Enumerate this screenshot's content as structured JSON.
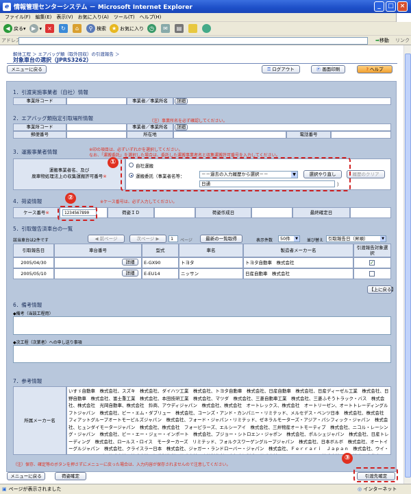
{
  "window": {
    "title": "情報管理センターシステム － Microsoft Internet Explorer",
    "min": "_",
    "max": "□",
    "close": "×"
  },
  "menu": [
    "ファイル(F)",
    "編集(E)",
    "表示(V)",
    "お気に入り(A)",
    "ツール(T)",
    "ヘルプ(H)"
  ],
  "toolbar": {
    "back": "戻る",
    "search": "検索",
    "favorites": "お気に入り"
  },
  "address": {
    "label": "アドレス(D)",
    "go": "移動",
    "links": "リンク"
  },
  "page": {
    "breadcrumb": "解体工程 ＞ エアバッグ類（取外回収）の引渡報告 ＞",
    "title": "対象車台の選択（JPRS3262）",
    "menu_back": "メニューに戻る",
    "logout": "ログアウト",
    "print": "画面印刷",
    "help": "ヘルプ"
  },
  "s1": {
    "heading": "1．引渡実施事業者（自社）情報",
    "code_label": "事業所コード",
    "name_label": "事業者／事業所名",
    "detail": "詳細"
  },
  "s2": {
    "heading": "2．エアバッグ類指定引取場所情報",
    "note": "（注）事業所名を必ず確認してください。",
    "code_label": "事業所コード",
    "name_label": "事業者／事業所名",
    "detail": "詳細",
    "zip_label": "郵便番号",
    "addr_label": "所在地",
    "tel_label": "電話番号"
  },
  "s3": {
    "heading": "3．運搬事業者情報",
    "note1": "※印の項目は、必ずいずれかを選択してください。",
    "note2": "なお、「運搬委託」を選択した場合は、委託した運搬事業者名と収集運搬許可番号を入力してください。",
    "row_label1": "運搬事業者名、及び",
    "row_label2": "廃車物処理法上の収集運搬許可番号",
    "req": "※",
    "opt_self": "自社運搬",
    "opt_consign": "運搬委託（事業者名等：",
    "select_value": "－－過去の入力履歴から選択－－",
    "select_btn": "選択やり直し",
    "clear_btn": "履歴のクリア",
    "input_value": "日通",
    "close_paren": "）"
  },
  "s4": {
    "heading": "4．荷姿情報",
    "note": "※ケース番号は、必ず入力してください。",
    "case_label": "ケース番号",
    "req": "※",
    "case_value": "1234567890",
    "packid_label": "荷姿ＩＤ",
    "created_label": "荷姿作成日",
    "confirmed_label": "最終確定日"
  },
  "s5": {
    "heading": "5．引取報告済車台の一覧",
    "count": "該当車台は2件です",
    "prev": "前ページ",
    "next": "次ページ",
    "page": "1",
    "page_unit": "ページ",
    "latest": "最新の一覧取得",
    "per_page_label": "表示件数",
    "per_page": "50件",
    "sort_label": "並び替え",
    "sort": "引取報告日（昇順）",
    "headers": [
      "引取報告日",
      "車台番号",
      "型式",
      "車名",
      "製造者メーカー名",
      "引渡報告対象選択"
    ],
    "rows": [
      {
        "date": "2005/04/30",
        "detail": "詳細",
        "model": "E-GX90",
        "name": "トヨタ",
        "maker": "トヨタ自動車　株式会社",
        "checked": true
      },
      {
        "date": "2005/05/10",
        "detail": "詳細",
        "model": "E-EU14",
        "name": "ニッサン",
        "maker": "日産自動車　株式会社",
        "checked": false
      }
    ],
    "to_top": "上に戻る"
  },
  "s6": {
    "heading": "6．備考情報",
    "memo1": "◆備考（当該工程用）",
    "memo2": "◆次工程（次業者）への申し送り事項"
  },
  "s7": {
    "heading": "7．参考情報",
    "maker_label": "所属メーカー名",
    "makers": "いすゞ自動車　株式会社、スズキ　株式会社、ダイハツ工業　株式会社、トヨタ自動車　株式会社、日産自動車　株式会社、日産ディーゼル工業　株式会社、日野自動車　株式会社、富士重工業　株式会社、本田技研工業　株式会社、マツダ　株式会社、三菱自動車工業　株式会社、三菱ふそうトラック・バス　株式会社、株式会社　光岡自動車、株式会社　鈴商、アウディジャパン　株式会社、株式会社　オートレックス、株式会社　オートリーゼン、オートトレーディングルフトジャパン　株式会社、ビー・エム・ダブリュー　株式会社、コーンズ・アンド・カンパニー・リミテッド、メルセデス・ベンツ日本　株式会社、株式会社　フィアットグループオートモービルズジャパン　株式会社、フォード・ジャパン・リミテッド、ゼネラルモーターズ・アジア・パシフィック・ジャパン　株式会社、ヒュンダイモータージャパン　株式会社、株式会社　フォーピラーズ、エルシーアイ　株式会社、三井物産オートモーティブ　株式会社、ニコル・レーシング・ジャパン　株式会社、ビー・エー・ジェー・インポート　株式会社、プジョー・シトロエン・ジャポン　株式会社、ポルシェジャパン　株式会社、日産トレーディング　株式会社、ロールス・ロイス　モーターカーズ　リミテッド、フォルクスワーゲングループジャパン　株式会社、日本ボルボ　株式会社、オートイーグルジャパン　株式会社、クライスラー日本　株式会社、ジャガー・ランドローバー・ジャパン　株式会社、Ｆｅｒｒａｒｉ　Ｊａｐａｎ　株式会社、ウイ・エンジニアリング　株式会社、株式会社　加藤製作所、株式会社　小松製作所、東急車輛製造　株式会社、コベルコクレーン　株式会社、酎田法人　自動車リサイクル促進センター　再資源化支援部"
  },
  "footer": {
    "note": "（注）保存、確定等のボタンを押さずにメニューに戻った場合は、入力内容が保存されませんので注意してください。",
    "menu_back": "メニューに戻る",
    "confirm": "荷姿確定",
    "report_confirm": "引渡先確定"
  },
  "callouts": [
    "①",
    "②",
    "③"
  ],
  "status": {
    "left": "ページが表示されました",
    "zone": "インターネット"
  },
  "colors": {
    "accent": "#1d4fc8",
    "panel": "#b8c7dc",
    "callout": "#e03020"
  }
}
